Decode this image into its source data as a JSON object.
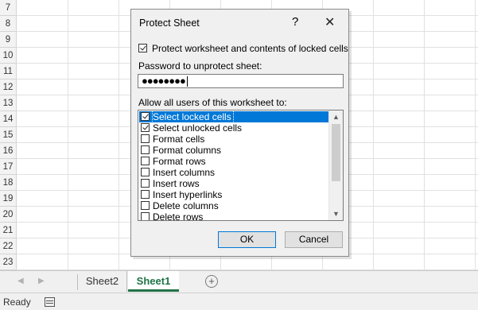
{
  "sheet": {
    "row_numbers": [
      "7",
      "8",
      "9",
      "10",
      "11",
      "12",
      "13",
      "14",
      "15",
      "16",
      "17",
      "18",
      "19",
      "20",
      "21",
      "22",
      "23"
    ]
  },
  "tabs": {
    "nav_prev": "◀",
    "nav_next": "▶",
    "sheet2_label": "Sheet2",
    "sheet1_label": "Sheet1",
    "add_sheet": "+",
    "active_color": "#217346"
  },
  "status": {
    "text": "Ready"
  },
  "dialog": {
    "title": "Protect Sheet",
    "help": "?",
    "close": "✕",
    "protect_label": "Protect worksheet and contents of locked cells",
    "protect_checked": true,
    "password_label": "Password to unprotect sheet:",
    "password_value": "●●●●●●●●",
    "allow_label": "Allow all users of this worksheet to:",
    "permissions": [
      {
        "label": "Select locked cells",
        "checked": true,
        "selected": true
      },
      {
        "label": "Select unlocked cells",
        "checked": true,
        "selected": false
      },
      {
        "label": "Format cells",
        "checked": false,
        "selected": false
      },
      {
        "label": "Format columns",
        "checked": false,
        "selected": false
      },
      {
        "label": "Format rows",
        "checked": false,
        "selected": false
      },
      {
        "label": "Insert columns",
        "checked": false,
        "selected": false
      },
      {
        "label": "Insert rows",
        "checked": false,
        "selected": false
      },
      {
        "label": "Insert hyperlinks",
        "checked": false,
        "selected": false
      },
      {
        "label": "Delete columns",
        "checked": false,
        "selected": false
      },
      {
        "label": "Delete rows",
        "checked": false,
        "selected": false
      }
    ],
    "ok_label": "OK",
    "cancel_label": "Cancel",
    "selection_color": "#0078d7"
  }
}
